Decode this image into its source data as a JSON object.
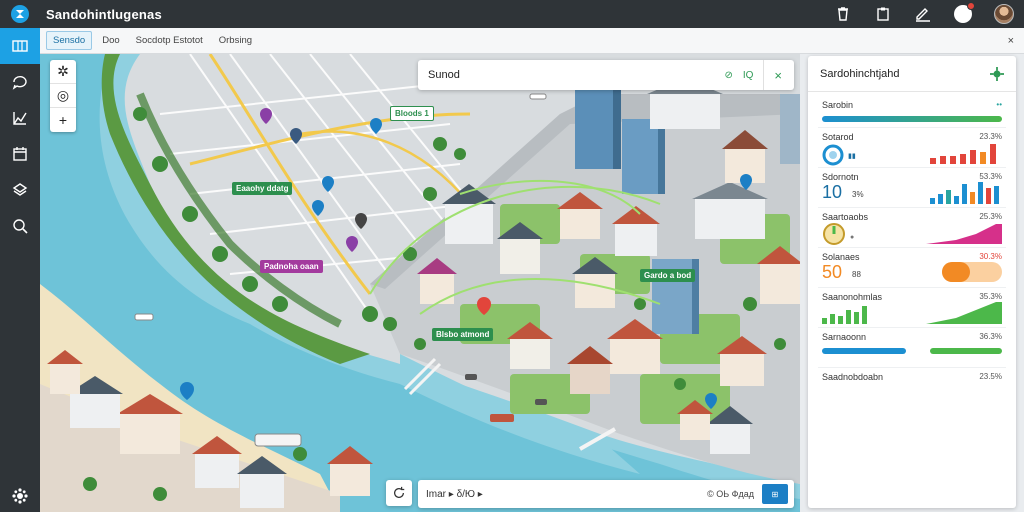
{
  "app": {
    "title": "Sandohintlugenas"
  },
  "tabs": [
    {
      "label": "Sensdo",
      "active": true
    },
    {
      "label": "Doo",
      "active": false
    },
    {
      "label": "Socdotp Estotot",
      "active": false
    },
    {
      "label": "Orbsing",
      "active": false
    }
  ],
  "tabs_close": "×",
  "rail": {
    "items": [
      "map-icon",
      "chat-icon",
      "chart-icon",
      "calendar-icon",
      "layers-icon",
      "search-icon"
    ],
    "bottom": "settings-icon"
  },
  "topbar": {
    "icons": [
      "trash-icon",
      "clipboard-icon",
      "edit-icon",
      "notification-icon",
      "avatar"
    ]
  },
  "zoom": {
    "compass": "✲",
    "locate": "◎",
    "plus": "+"
  },
  "search": {
    "value": "Sunod",
    "right_icon_label": "IQ",
    "close": "×"
  },
  "map_labels": {
    "l1": "Bloods 1",
    "l2": "Eaaohy ddatg",
    "l3": "Padnoha oaan",
    "l4": "Gardo a bod",
    "l5": "Blsbo atmond"
  },
  "bottombar": {
    "value": "Imar ▸ δ/Ю ▸",
    "meta": "© ОЬ Фдад",
    "button": "⊞"
  },
  "panel": {
    "title": "Sardohinchtjahd",
    "section": "Sarobin",
    "rows": [
      {
        "label": "Sotarod",
        "value": "23.3%"
      },
      {
        "label": "Sdornotn",
        "value": "53.3%",
        "big": "10",
        "sub": "3%"
      },
      {
        "label": "Saartoaobs",
        "value": "25.3%"
      },
      {
        "label": "Solanaes",
        "value": "30.3%",
        "big": "50",
        "sub": "88"
      },
      {
        "label": "Saanonohmlas",
        "value": "35.3%"
      },
      {
        "label": "Sarnaoonn",
        "value": "36.3%"
      },
      {
        "label": "Saadnobdoabn",
        "value": "23.5%"
      }
    ],
    "colors": {
      "blue": "#1c8fd1",
      "red": "#e2453b",
      "magenta": "#d6308a",
      "orange": "#f28a24",
      "green": "#4cb84a",
      "teal": "#2aa5a0"
    }
  }
}
